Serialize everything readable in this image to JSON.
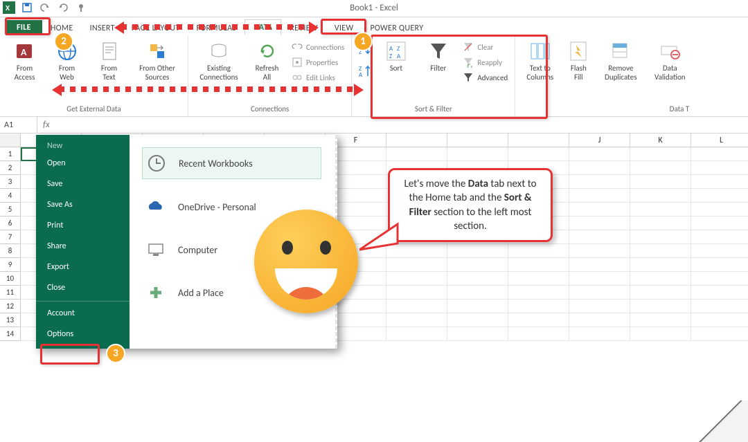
{
  "window": {
    "title": "Book1 - Excel"
  },
  "tabs": {
    "file": "FILE",
    "home": "HOME",
    "insert": "INSERT",
    "pagelayout": "PAGE LAYOUT",
    "formulas": "FORMULAS",
    "data": "DATA",
    "review": "REVIEW",
    "view": "VIEW",
    "powerquery": "POWER QUERY"
  },
  "ribbon": {
    "getdata": {
      "label": "Get External Data",
      "access": "From\nAccess",
      "web": "From\nWeb",
      "text": "From\nText",
      "other": "From Other\nSources"
    },
    "connections": {
      "label": "Connections",
      "existing": "Existing\nConnections",
      "refresh": "Refresh\nAll",
      "conn": "Connections",
      "prop": "Properties",
      "editlinks": "Edit Links"
    },
    "sortfilter": {
      "label": "Sort & Filter",
      "sort": "Sort",
      "filter": "Filter",
      "clear": "Clear",
      "reapply": "Reapply",
      "advanced": "Advanced"
    },
    "tools": {
      "label": "Data Tools",
      "t2c": "Text to\nColumns",
      "flash": "Flash\nFill",
      "dup": "Remove\nDuplicates",
      "valid": "Data\nValidation"
    }
  },
  "namebox": "A1",
  "cols": [
    "F",
    "J",
    "K",
    "L"
  ],
  "rows": [
    "1",
    "2",
    "3",
    "4",
    "5",
    "6",
    "7",
    "8",
    "9",
    "10",
    "11",
    "12",
    "13",
    "14"
  ],
  "backstage": {
    "items": [
      "New",
      "Open",
      "Save",
      "Save As",
      "Print",
      "Share",
      "Export",
      "Close"
    ],
    "account": "Account",
    "options": "Options",
    "loc_recent": "Recent Workbooks",
    "loc_onedrive": "OneDrive - Personal",
    "loc_computer": "Computer",
    "loc_add": "Add a Place"
  },
  "callout": {
    "pre": "Let's move the ",
    "b1": "Data",
    "mid1": " tab next to the Home tab and the ",
    "b2": "Sort & Filter",
    "mid2": " section to the left most section."
  },
  "badges": {
    "one": "1",
    "two": "2",
    "three": "3"
  }
}
